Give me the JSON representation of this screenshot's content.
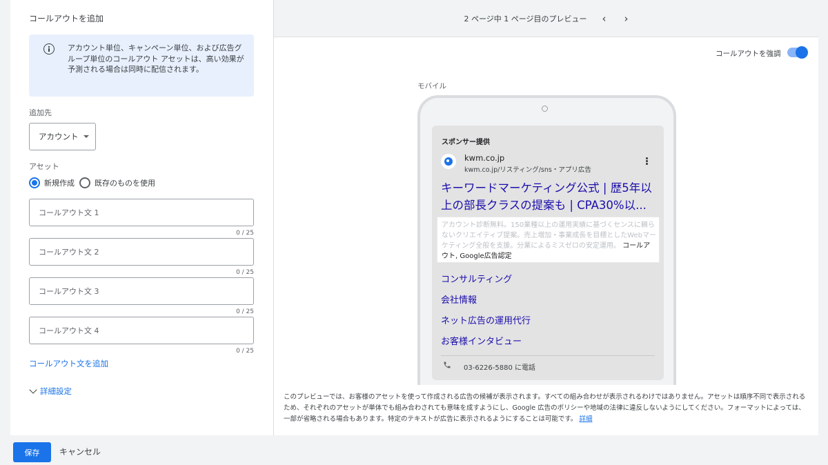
{
  "left": {
    "title": "コールアウトを追加",
    "info_text": "アカウント単位、キャンペーン単位、および広告グループ単位のコールアウト アセットは、高い効果が予測される場合は同時に配信されます。",
    "target_label": "追加先",
    "target_value": "アカウント",
    "asset_label": "アセット",
    "radio_new": "新規作成",
    "radio_existing": "既存のものを使用",
    "fields": [
      {
        "placeholder": "コールアウト文 1",
        "counter": "0 / 25"
      },
      {
        "placeholder": "コールアウト文 2",
        "counter": "0 / 25"
      },
      {
        "placeholder": "コールアウト文 3",
        "counter": "0 / 25"
      },
      {
        "placeholder": "コールアウト文 4",
        "counter": "0 / 25"
      }
    ],
    "add_link": "コールアウト文を追加",
    "details": "詳細設定"
  },
  "preview": {
    "page_text": "2 ページ中 1 ページ目のプレビュー",
    "prev_icon": "chevron-left-icon",
    "next_icon": "chevron-right-icon",
    "highlight_label": "コールアウトを強調",
    "highlight_on": true,
    "device_label": "モバイル",
    "ad": {
      "sponsor": "スポンサー提供",
      "domain": "kwm.co.jp",
      "url": "kwm.co.jp/リスティング/sns・アプリ広告",
      "headline": "キーワードマーケティング公式 | 歴5年以上の部長クラスの提案も | CPA30%以...",
      "description": "アカウント診断無料。150業種以上の運用実績に基づくセンスに頼らないクリエイティブ提案。売上増加・事業成長を目標としたWebマーケティング全般を支援。分業によるミスゼロの安定運用。",
      "callout": "コールアウト, Google広告認定",
      "sitelinks": [
        "コンサルティング",
        "会社情報",
        "ネット広告の運用代行",
        "お客様インタビュー"
      ],
      "phone": "03-6226-5880 に電話"
    },
    "note": "このプレビューでは、お客様のアセットを使って作成される広告の候補が表示されます。すべての組み合わせが表示されるわけではありません。アセットは順序不同で表示されるため、それぞれのアセットが単体でも組み合わされても意味を成すようにし、Google 広告のポリシーや地域の法律に違反しないようにしてください。フォーマットによっては、一部が省略される場合もあります。特定のテキストが広告に表示されるようにすることは可能です。",
    "note_link": "詳細"
  },
  "footer": {
    "save": "保存",
    "cancel": "キャンセル"
  }
}
